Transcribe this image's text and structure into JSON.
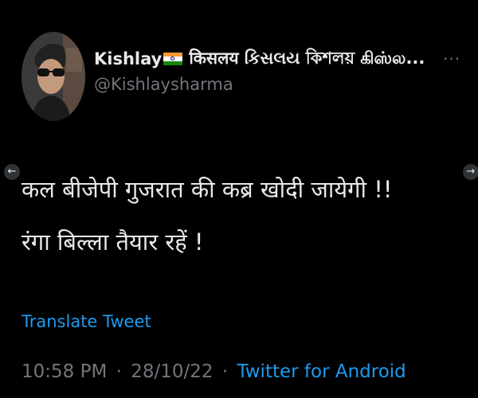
{
  "author": {
    "display_name_prefix": "Kishlay",
    "display_name_rest": "किसलय કિસલય কিশলয় கிஸ்ல...",
    "handle": "@Kishlaysharma",
    "flag_icon": "india-flag-icon",
    "avatar_icon": "avatar-photo"
  },
  "tweet": {
    "lines": [
      "कल बीजेपी गुजरात की कब्र खोदी जायेगी !!",
      "रंगा बिल्ला तैयार रहें !"
    ],
    "translate_label": "Translate Tweet"
  },
  "meta": {
    "time": "10:58 PM",
    "separator": "·",
    "date": "28/10/22",
    "source": "Twitter for Android"
  },
  "controls": {
    "more_label": "···",
    "prev_arrow": "←",
    "next_arrow": "→"
  },
  "colors": {
    "background": "#000000",
    "text": "#e7e9ea",
    "secondary": "#71767b",
    "link": "#1d9bf0"
  }
}
